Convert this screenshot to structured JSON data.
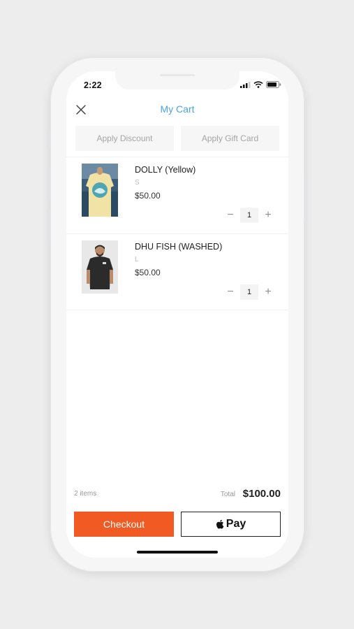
{
  "status_bar": {
    "time": "2:22"
  },
  "header": {
    "title": "My Cart"
  },
  "actions": {
    "discount_label": "Apply Discount",
    "gift_card_label": "Apply Gift Card"
  },
  "cart": {
    "items": [
      {
        "name": "DOLLY (Yellow)",
        "size": "S",
        "price": "$50.00",
        "quantity": "1",
        "image": "yellow-tshirt-back-image"
      },
      {
        "name": "DHU FISH (WASHED)",
        "size": "L",
        "price": "$50.00",
        "quantity": "1",
        "image": "man-in-black-tshirt-image"
      }
    ]
  },
  "summary": {
    "items_count": "2 items",
    "total_label": "Total",
    "total_amount": "$100.00"
  },
  "buttons": {
    "checkout_label": "Checkout",
    "apple_pay_label": "Pay"
  },
  "colors": {
    "accent": "#4aa3e6",
    "checkout": "#f25a24",
    "background": "#ededee"
  }
}
